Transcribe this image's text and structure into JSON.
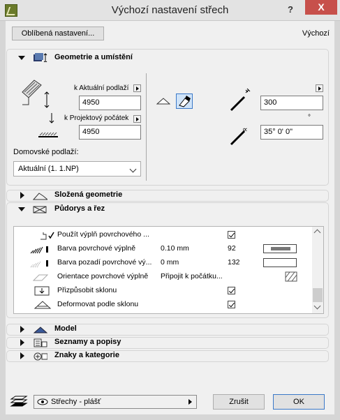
{
  "window": {
    "title": "Výchozí nastavení střech",
    "help": "?",
    "close": "X"
  },
  "header": {
    "favorites_button": "Oblíbená nastavení...",
    "default_label": "Výchozí"
  },
  "geometry": {
    "section_title": "Geometrie a umístění",
    "current_floor_label": "k Aktuální podlaží",
    "current_floor_value": "4950",
    "project_origin_label": "k Projektový počátek",
    "project_origin_value": "4950",
    "home_floor_label": "Domovské podlaží:",
    "home_floor_value": "Aktuální (1. 1.NP)",
    "thickness_value": "300",
    "degree_symbol": "°",
    "angle_value": "35° 0' 0\""
  },
  "sections": {
    "complex": "Složená geometrie",
    "plan": "Půdorys a řez",
    "model": "Model",
    "listing": "Seznamy a popisy",
    "tags": "Znaky a kategorie"
  },
  "plan_rows": [
    {
      "name": "Použít výplň povrchového ...",
      "value": "",
      "extra": "",
      "checked": true
    },
    {
      "name": "Barva povrchové výplně",
      "value": "0.10 mm",
      "extra": "92"
    },
    {
      "name": "Barva pozadí povrchové vý...",
      "value": "0 mm",
      "extra": "132"
    },
    {
      "name": "Orientace povrchové výplně",
      "value": "Připojit k počátku...",
      "extra": ""
    },
    {
      "name": "Přizpůsobit sklonu",
      "value": "",
      "extra": "",
      "checked": true
    },
    {
      "name": "Deformovat podle sklonu",
      "value": "",
      "extra": "",
      "checked": true
    }
  ],
  "footer": {
    "layer_value": "Střechy - plášť",
    "cancel": "Zrušit",
    "ok": "OK"
  },
  "colors": {
    "close_red": "#c7504b",
    "panel_bg": "#f0f0f0",
    "accent_blue": "#3a78c8"
  }
}
